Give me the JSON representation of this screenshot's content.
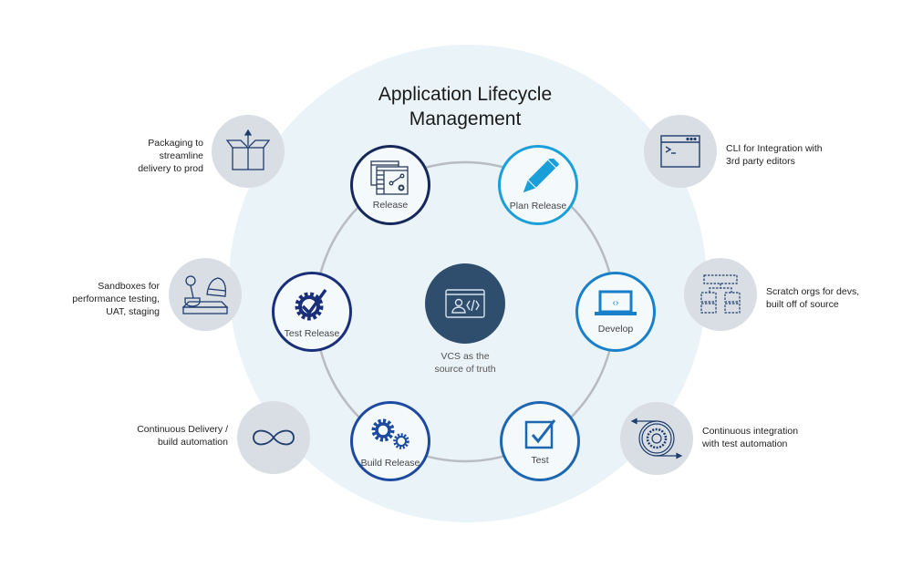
{
  "title": {
    "line1": "Application Lifecycle",
    "line2": "Management"
  },
  "center": {
    "icon": "vcs-code-window-icon",
    "caption_line1": "VCS as the",
    "caption_line2": "source of truth",
    "color": "#2f4e6e"
  },
  "cycle_nodes": [
    {
      "label": "Release",
      "icon": "release-windows-icon",
      "color": "#16275a"
    },
    {
      "label": "Plan Release",
      "icon": "pencil-icon",
      "color": "#1a9fd9"
    },
    {
      "label": "Develop",
      "icon": "laptop-code-icon",
      "color": "#1a7fc9"
    },
    {
      "label": "Test",
      "icon": "checkbox-icon",
      "color": "#1d66b0"
    },
    {
      "label": "Build Release",
      "icon": "gears-icon",
      "color": "#1c4aa0"
    },
    {
      "label": "Test Release",
      "icon": "gear-check-icon",
      "color": "#1a2f7a"
    }
  ],
  "side_notes": [
    {
      "lines": [
        "Packaging to",
        "streamline",
        "delivery to prod"
      ],
      "icon": "open-box-icon"
    },
    {
      "lines": [
        "CLI for Integration with",
        "3rd party editors"
      ],
      "icon": "terminal-window-icon"
    },
    {
      "lines": [
        "Sandboxes for",
        "performance testing,",
        "UAT, staging"
      ],
      "icon": "sandbox-icon"
    },
    {
      "lines": [
        "Scratch orgs for devs,",
        "built off of source"
      ],
      "icon": "org-chart-dashed-icon"
    },
    {
      "lines": [
        "Continuous Delivery /",
        "build automation"
      ],
      "icon": "infinity-icon"
    },
    {
      "lines": [
        "Continuous integration",
        "with test automation"
      ],
      "icon": "gear-cycle-icon"
    }
  ],
  "colors": {
    "background_circle": "#eaf3f7",
    "side_circle": "#d8dee3",
    "ring_line": "#b8bcc0",
    "icon_navy": "#1f3c6e"
  }
}
